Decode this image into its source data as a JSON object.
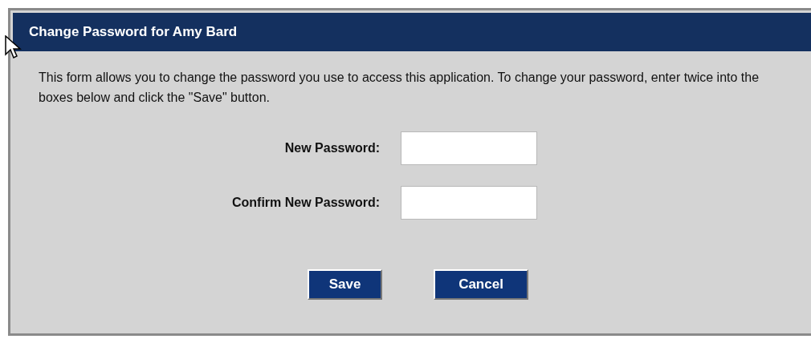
{
  "dialog": {
    "title": "Change Password for Amy Bard",
    "description": "This form allows you to change the password you use to access this application. To change your password, enter twice into the boxes below and click the \"Save\" button.",
    "fields": [
      {
        "label": "New Password:"
      },
      {
        "label": "Confirm New Password:"
      }
    ],
    "buttons": [
      "Save",
      "Cancel"
    ]
  }
}
